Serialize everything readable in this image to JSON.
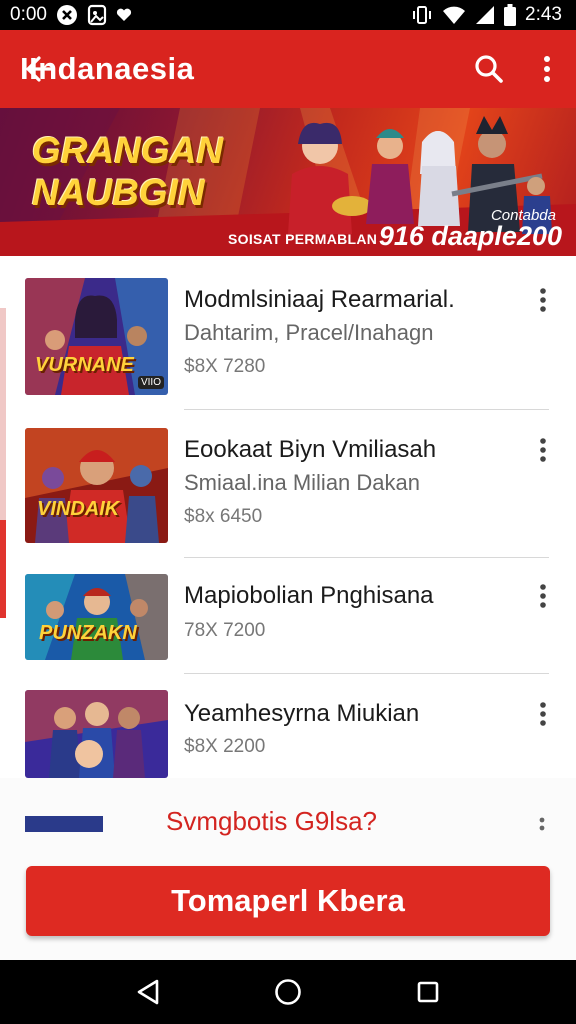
{
  "status_bar": {
    "time_left": "0:00",
    "time_right": "2:43",
    "icons_left": [
      "x-circle-icon",
      "photo-icon",
      "heart-icon"
    ],
    "icons_right": [
      "vibrate-icon",
      "wifi-icon",
      "signal-icon",
      "battery-icon"
    ]
  },
  "app_bar": {
    "title": "IIndanaesia",
    "back_icon": "arrow-left-icon",
    "search_icon": "search-icon",
    "more_icon": "more-vertical-icon",
    "background": "#d9241f"
  },
  "banner": {
    "title_line1": "GRANGAN",
    "title_line2": "NAUBGIN",
    "footer_left": "SOISAT PERMABLAN",
    "footer_right": "916 daaple200",
    "footer_sup": "Contabda"
  },
  "items": [
    {
      "title": "Modmlsiniaaj Rearmarial.",
      "subtitle": "Dahtarim, Pracel/Inahagn",
      "price": "$8X 7280",
      "thumb_caption": "VURNANE",
      "thumb_badge": "VIIO"
    },
    {
      "title": "Eookaat Biyn Vmiliasah",
      "subtitle": "Smiaal.ina Milian Dakan",
      "price": "$8x 6450",
      "thumb_caption": "VINDAIK",
      "thumb_badge": ""
    },
    {
      "title": "Mapiobolian Pnghisana",
      "subtitle": "",
      "price": "78X 7200",
      "thumb_caption": "PUNZAKN",
      "thumb_badge": ""
    },
    {
      "title": "Yeamhesyrna Miukian",
      "subtitle": "",
      "price": "$8X 2200",
      "thumb_caption": "",
      "thumb_badge": ""
    }
  ],
  "bottom": {
    "question": "Svmgbotis G9lsa?",
    "cta_label": "Tomaperl Kbera",
    "accent": "#de2a22"
  },
  "nav_bar": {
    "back_icon": "triangle-back-icon",
    "home_icon": "circle-home-icon",
    "recents_icon": "square-recents-icon"
  }
}
